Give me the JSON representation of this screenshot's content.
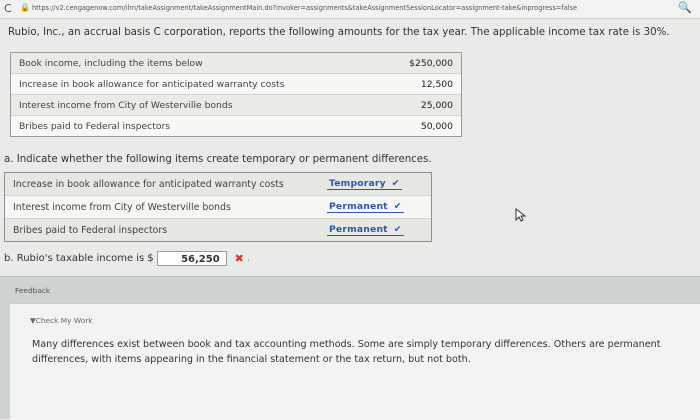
{
  "browser": {
    "reload_glyph": "C",
    "lock_glyph": "🔒",
    "url": "https://v2.cengagenow.com/ilrn/takeAssignment/takeAssignmentMain.do?invoker=assignments&takeAssignmentSessionLocator=assignment-take&inprogress=false",
    "zoom_glyph": "🔍"
  },
  "problem": {
    "intro": "Rubio, Inc., an accrual basis C corporation, reports the following amounts for the tax year. The applicable income tax rate is 30%.",
    "amounts": [
      {
        "label": "Book income, including the items below",
        "value": "$250,000"
      },
      {
        "label": "Increase in book allowance for anticipated warranty costs",
        "value": "12,500"
      },
      {
        "label": "Interest income from City of Westerville bonds",
        "value": "25,000"
      },
      {
        "label": "Bribes paid to Federal inspectors",
        "value": "50,000"
      }
    ]
  },
  "part_a": {
    "prompt": "a.  Indicate whether the following items create temporary or permanent differences.",
    "items": [
      {
        "label": "Increase in book allowance for anticipated warranty costs",
        "answer": "Temporary",
        "mark": "✔"
      },
      {
        "label": "Interest income from City of Westerville bonds",
        "answer": "Permanent",
        "mark": "✔"
      },
      {
        "label": "Bribes paid to Federal inspectors",
        "answer": "Permanent",
        "mark": "✔"
      }
    ]
  },
  "part_b": {
    "prompt": "b.  Rubio's taxable income is",
    "currency": "$",
    "value": "56,250",
    "mark": "✖",
    "suffix": "."
  },
  "feedback": {
    "title": "Feedback",
    "check_label": "▼Check My Work",
    "message": "Many differences exist between book and tax accounting methods. Some are simply temporary differences. Others are permanent differences, with items appearing in the financial statement or the tax return, but not both."
  },
  "colors": {
    "answer": "#2f57a8",
    "incorrect": "#d23b2e"
  }
}
